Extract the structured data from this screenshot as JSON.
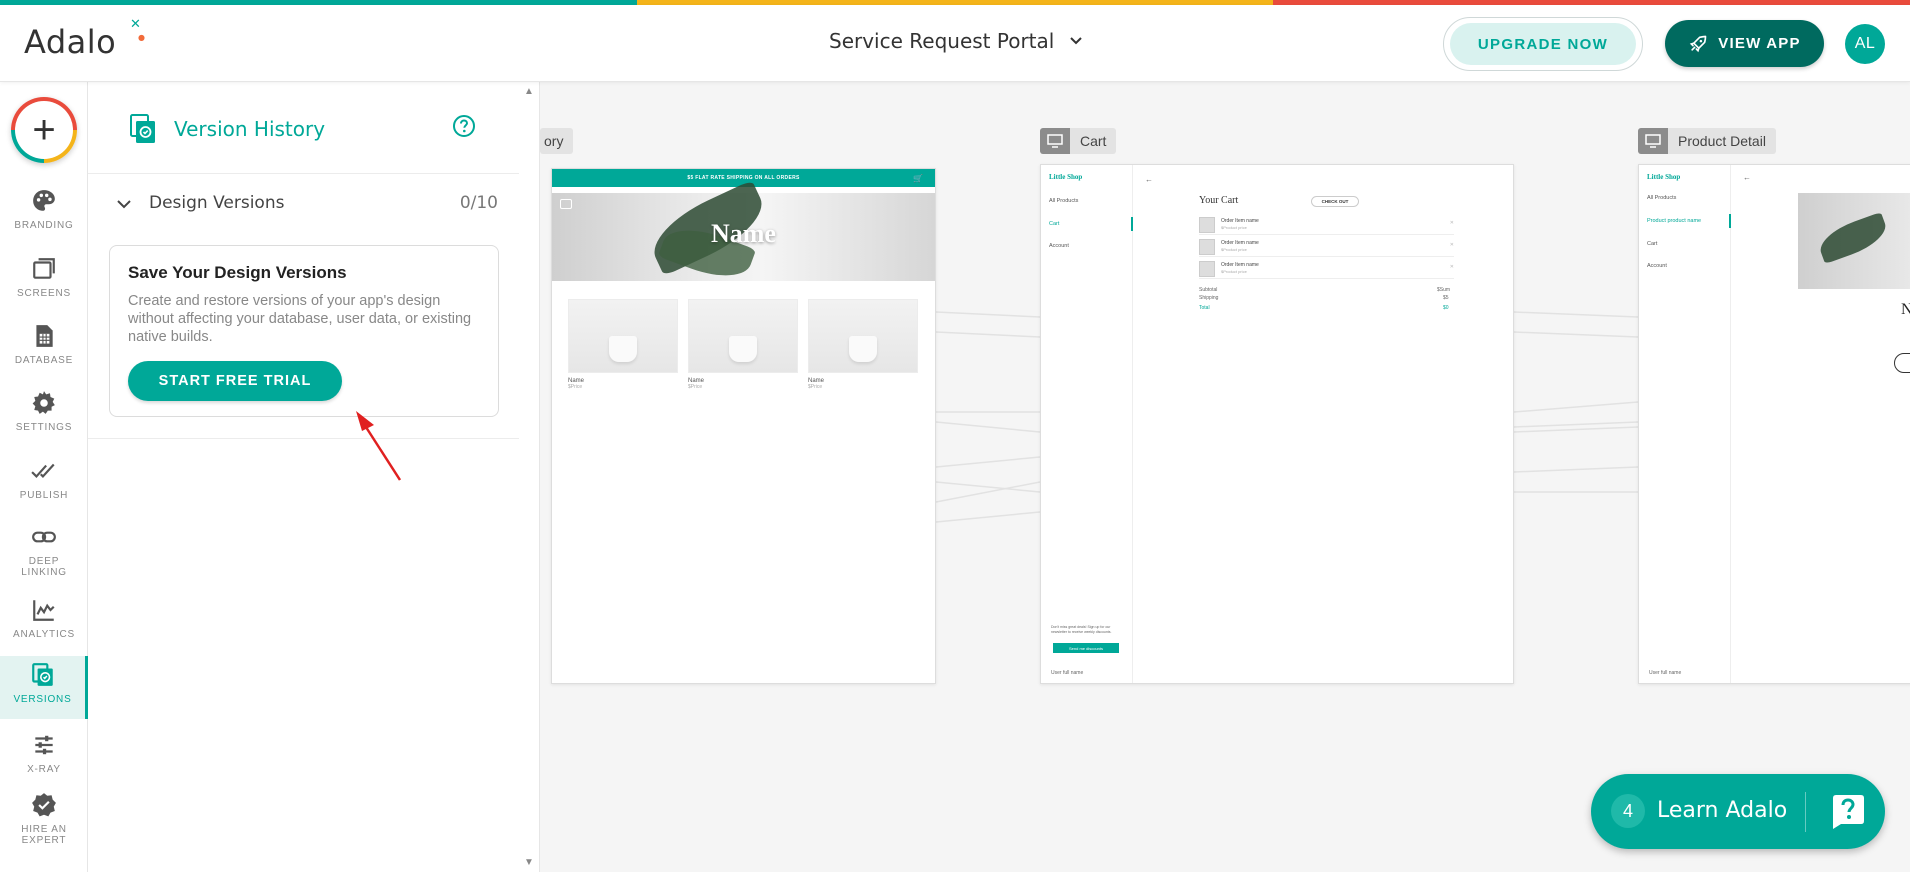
{
  "colors": {
    "accent": "#00a898",
    "accent_dark": "#006a5f",
    "rainbow": [
      "#00a898",
      "#f4b41a",
      "#e94b3c"
    ]
  },
  "header": {
    "logo": "Adalo",
    "app_title": "Service Request Portal",
    "upgrade_label": "UPGRADE NOW",
    "view_app_label": "VIEW APP",
    "avatar_initials": "AL"
  },
  "leftnav": {
    "add_label": "+",
    "items": [
      {
        "label": "BRANDING",
        "icon": "palette-icon"
      },
      {
        "label": "SCREENS",
        "icon": "screens-icon"
      },
      {
        "label": "DATABASE",
        "icon": "database-icon"
      },
      {
        "label": "SETTINGS",
        "icon": "gear-icon"
      },
      {
        "label": "PUBLISH",
        "icon": "double-check-icon"
      },
      {
        "label": "DEEP LINKING",
        "icon": "link-icon"
      },
      {
        "label": "ANALYTICS",
        "icon": "analytics-icon"
      },
      {
        "label": "VERSIONS",
        "icon": "versions-icon",
        "active": true
      },
      {
        "label": "X-RAY",
        "icon": "sliders-icon"
      },
      {
        "label": "HIRE AN EXPERT",
        "icon": "badge-check-icon"
      }
    ]
  },
  "version_panel": {
    "title": "Version History",
    "section_label": "Design Versions",
    "section_count": "0/10",
    "card_title": "Save Your Design Versions",
    "card_description": "Create and restore versions of your app's design without affecting your database, user data, or existing native builds.",
    "cta_label": "START FREE TRIAL"
  },
  "canvas": {
    "screens": [
      {
        "label": "ory",
        "banner": "$5 FLAT RATE SHIPPING ON ALL ORDERS",
        "hero_text": "Name",
        "products": [
          {
            "name": "Name",
            "price": "$Price"
          },
          {
            "name": "Name",
            "price": "$Price"
          },
          {
            "name": "Name",
            "price": "$Price"
          }
        ]
      },
      {
        "label": "Cart",
        "shop": "Little Shop",
        "nav": [
          "All Products",
          "Cart",
          "Account"
        ],
        "title": "Your Cart",
        "checkout": "CHECK OUT",
        "orders": [
          {
            "name": "Order Item name",
            "price": "$Product price"
          },
          {
            "name": "Order Item name",
            "price": "$Product price"
          },
          {
            "name": "Order Item name",
            "price": "$Product price"
          }
        ],
        "subtotal_label": "Subtotal",
        "subtotal_value": "$Sum",
        "shipping_label": "Shipping",
        "shipping_value": "$5",
        "total_label": "Total",
        "total_value": "$0",
        "promo_text": "Don't miss great deals! Sign up for our newsletter to receive weekly discounts.",
        "promo_button": "Send me discounts",
        "user": "User full name"
      },
      {
        "label": "Product Detail",
        "shop": "Little Shop",
        "nav": [
          "All Products",
          "Product product name",
          "Cart",
          "Account"
        ],
        "hero_text": "N",
        "user": "User full name"
      }
    ]
  },
  "learn": {
    "count": "4",
    "label": "Learn Adalo"
  }
}
